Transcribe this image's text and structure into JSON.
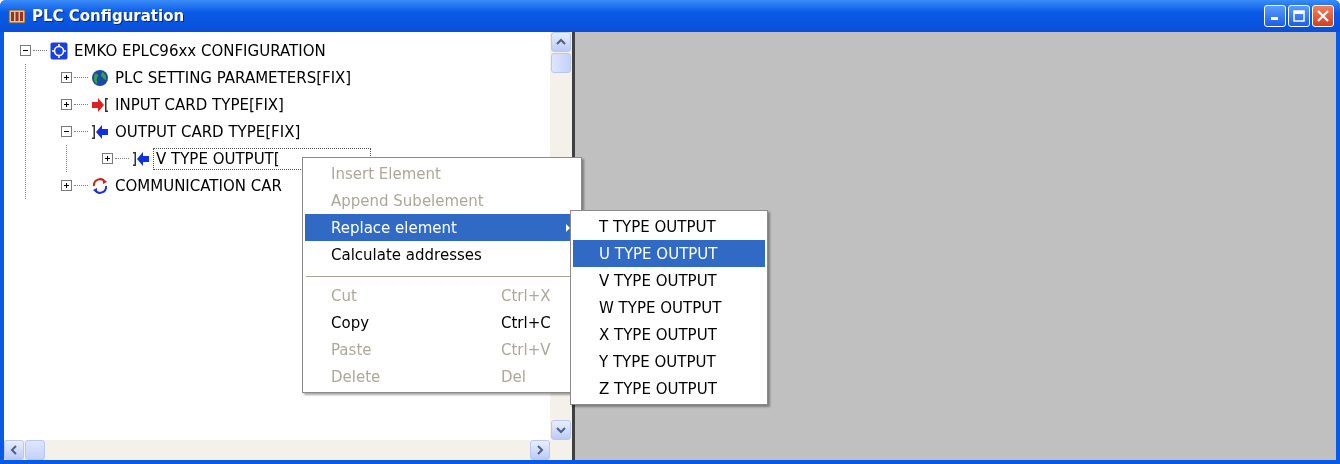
{
  "window": {
    "title": "PLC Configuration"
  },
  "tree": [
    {
      "label": "EMKO EPLC96xx CONFIGURATION",
      "kind": "root",
      "expanded": true,
      "selected": false,
      "children": [
        {
          "label": "PLC SETTING PARAMETERS[FIX]",
          "kind": "settings",
          "expanded": false,
          "selected": false
        },
        {
          "label": "INPUT CARD TYPE[FIX]",
          "kind": "input",
          "expanded": false,
          "selected": false
        },
        {
          "label": "OUTPUT CARD TYPE[FIX]",
          "kind": "output",
          "expanded": true,
          "selected": false,
          "children": [
            {
              "label": "V TYPE OUTPUT[",
              "kind": "output",
              "expanded": false,
              "selected": true
            }
          ]
        },
        {
          "label": "COMMUNICATION CAR",
          "kind": "communication",
          "expanded": false,
          "selected": false
        }
      ]
    }
  ],
  "context_menu": [
    {
      "kind": "item",
      "label": "Insert Element",
      "disabled": true,
      "selected": false
    },
    {
      "kind": "item",
      "label": "Append Subelement",
      "disabled": true,
      "selected": false
    },
    {
      "kind": "submenu",
      "label": "Replace element",
      "disabled": false,
      "selected": true
    },
    {
      "kind": "item",
      "label": "Calculate addresses",
      "disabled": false,
      "selected": false
    },
    {
      "kind": "separator"
    },
    {
      "kind": "item",
      "label": "Cut",
      "shortcut": "Ctrl+X",
      "disabled": true,
      "selected": false
    },
    {
      "kind": "item",
      "label": "Copy",
      "shortcut": "Ctrl+C",
      "disabled": false,
      "selected": false
    },
    {
      "kind": "item",
      "label": "Paste",
      "shortcut": "Ctrl+V",
      "disabled": true,
      "selected": false
    },
    {
      "kind": "item",
      "label": "Delete",
      "shortcut": "Del",
      "disabled": true,
      "selected": false
    }
  ],
  "submenu": [
    {
      "label": "T TYPE OUTPUT",
      "selected": false
    },
    {
      "label": "U TYPE OUTPUT",
      "selected": true
    },
    {
      "label": "V TYPE OUTPUT",
      "selected": false
    },
    {
      "label": "W TYPE OUTPUT",
      "selected": false
    },
    {
      "label": "X TYPE OUTPUT",
      "selected": false
    },
    {
      "label": "Y TYPE OUTPUT",
      "selected": false
    },
    {
      "label": "Z TYPE OUTPUT",
      "selected": false
    }
  ]
}
